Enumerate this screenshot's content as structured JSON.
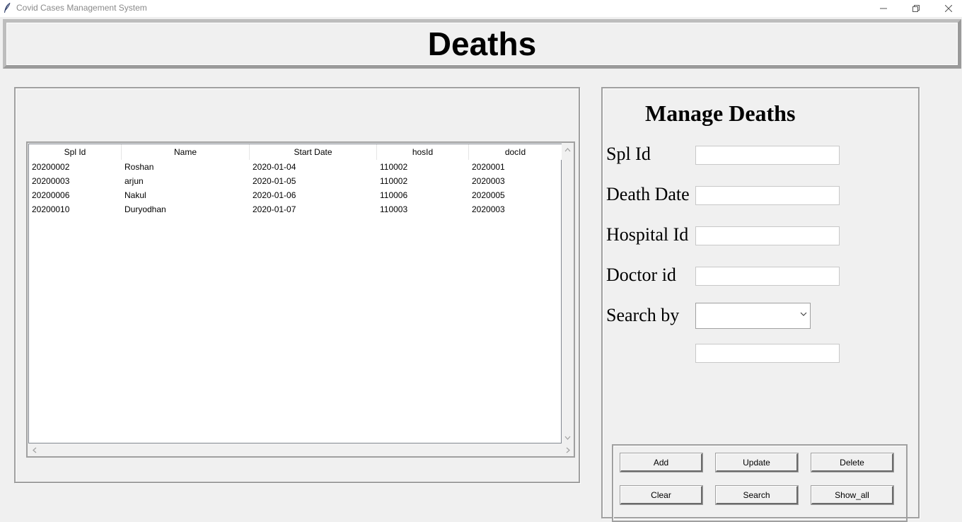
{
  "window": {
    "title": "Covid Cases Management System",
    "controls": {
      "minimize_icon": "minimize-icon",
      "maximize_icon": "restore-icon",
      "close_icon": "close-icon"
    }
  },
  "header": {
    "title": "Deaths"
  },
  "table": {
    "columns": [
      "Spl Id",
      "Name",
      "Start Date",
      "hosId",
      "docId"
    ],
    "rows": [
      [
        "20200002",
        "Roshan",
        "2020-01-04",
        "110002",
        "2020001"
      ],
      [
        "20200003",
        "arjun",
        "2020-01-05",
        "110002",
        "2020003"
      ],
      [
        "20200006",
        "Nakul",
        "2020-01-06",
        "110006",
        "2020005"
      ],
      [
        "20200010",
        "Duryodhan",
        "2020-01-07",
        "110003",
        "2020003"
      ]
    ]
  },
  "form": {
    "title": "Manage Deaths",
    "fields": {
      "spl_id": {
        "label": "Spl Id",
        "value": ""
      },
      "death_date": {
        "label": "Death Date",
        "value": ""
      },
      "hospital_id": {
        "label": "Hospital Id",
        "value": ""
      },
      "doctor_id": {
        "label": "Doctor id",
        "value": ""
      }
    },
    "search": {
      "label": "Search by",
      "selected": "",
      "text": ""
    }
  },
  "buttons": {
    "add": "Add",
    "update": "Update",
    "delete": "Delete",
    "clear": "Clear",
    "search": "Search",
    "show_all": "Show_all"
  },
  "colors": {
    "background": "#f0f0f0",
    "panel_border": "#a0a0a0",
    "input_bg": "#ffffff"
  }
}
